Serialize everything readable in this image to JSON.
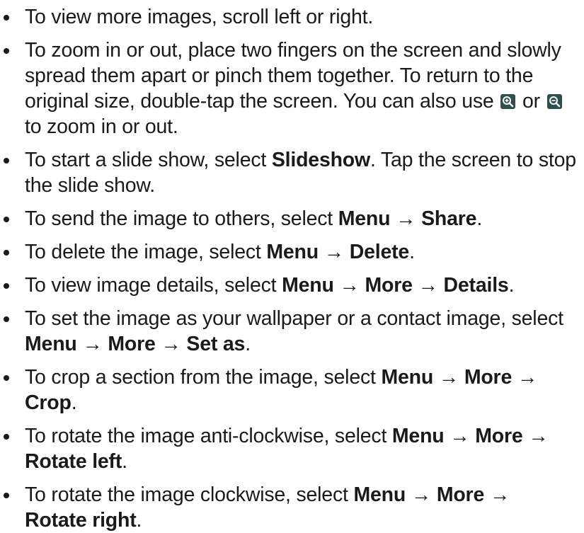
{
  "bullet_points": [
    {
      "text": "To view more images, scroll left or right."
    },
    {
      "pre": "To zoom in or out, place two fingers on the screen and slowly spread them apart or pinch them together. To return to the original size, double-tap the screen. You can also use ",
      "mid": " or ",
      "post": " to zoom in or out.",
      "icon1": "zoom-in-icon",
      "icon2": "zoom-out-icon"
    },
    {
      "pre": "To start a slide show, select ",
      "b1": "Slideshow",
      "post": ". Tap the screen to stop the slide show."
    },
    {
      "pre": "To send the image to others, select ",
      "b1": "Menu",
      "arrow1": " → ",
      "b2": "Share",
      "post": "."
    },
    {
      "pre": "To delete the image, select ",
      "b1": "Menu",
      "arrow1": " → ",
      "b2": "Delete",
      "post": "."
    },
    {
      "pre": "To view image details, select ",
      "b1": "Menu",
      "arrow1": " → ",
      "b2": "More",
      "arrow2": " → ",
      "b3": "Details",
      "post": "."
    },
    {
      "pre": "To set the image as your wallpaper or a contact image, select ",
      "b1": "Menu",
      "arrow1": " → ",
      "b2": "More",
      "arrow2": " → ",
      "b3": "Set as",
      "post": "."
    },
    {
      "pre": "To crop a section from the image, select ",
      "b1": "Menu",
      "arrow1": " → ",
      "b2": "More",
      "arrow2": " → ",
      "b3": "Crop",
      "post": "."
    },
    {
      "pre": "To rotate the image anti-clockwise, select ",
      "b1": "Menu",
      "arrow1": " → ",
      "b2": "More",
      "arrow2": " → ",
      "b3": "Rotate left",
      "post": "."
    },
    {
      "pre": "To rotate the image clockwise, select ",
      "b1": "Menu",
      "arrow1": " → ",
      "b2": "More",
      "arrow2": " → ",
      "b3": "Rotate right",
      "post": "."
    }
  ],
  "colors": {
    "text": "#1a1a1a",
    "icon_background": "#2f4f4f"
  }
}
